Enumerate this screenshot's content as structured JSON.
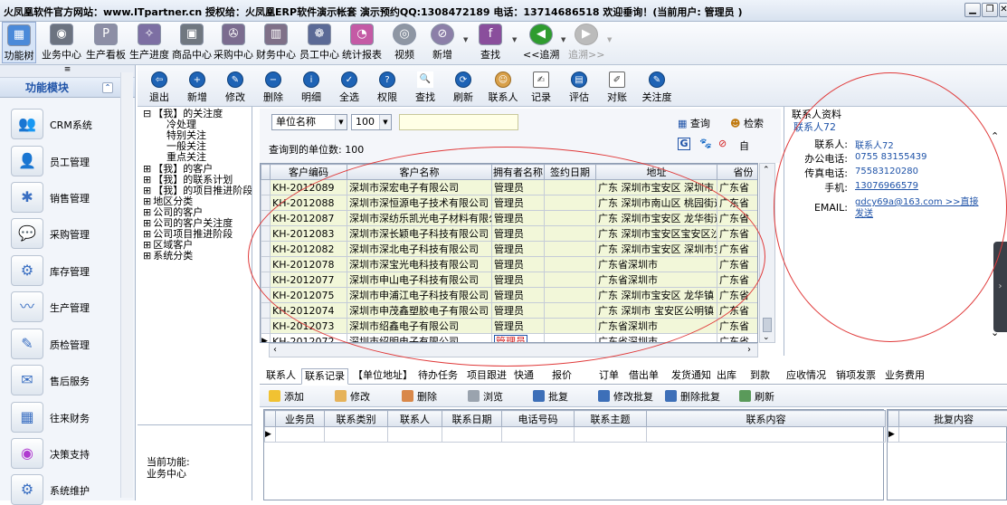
{
  "window": {
    "title": "火凤凰软件官方网站：www.ITpartner.cn  授权给：火凤凰ERP软件演示帐套 演示预约QQ:1308472189 电话：13714686518  欢迎垂询！(当前用户: 管理员 )"
  },
  "toolbar": [
    "功能树",
    "业务中心",
    "生产看板",
    "生产进度",
    "商品中心",
    "采购中心",
    "财务中心",
    "员工中心",
    "统计报表",
    "视频",
    "新增",
    "查找",
    "<<追溯",
    "追溯>>"
  ],
  "leftnav": {
    "collapse_glyph": "≡",
    "header": "功能模块",
    "items": [
      "CRM系统",
      "员工管理",
      "销售管理",
      "采购管理",
      "库存管理",
      "生产管理",
      "质检管理",
      "售后服务",
      "往来财务",
      "决策支持",
      "系统维护"
    ]
  },
  "tree": [
    {
      "label": "【我】的关注度",
      "exp": "⊟"
    },
    {
      "label": "冷处理",
      "exp": ""
    },
    {
      "label": "特别关注",
      "exp": ""
    },
    {
      "label": "一般关注",
      "exp": ""
    },
    {
      "label": "重点关注",
      "exp": ""
    },
    {
      "label": "【我】的客户",
      "exp": "⊞"
    },
    {
      "label": "【我】的联系计划",
      "exp": "⊞"
    },
    {
      "label": "【我】的项目推进阶段",
      "exp": "⊞"
    },
    {
      "label": "地区分类",
      "exp": "⊞"
    },
    {
      "label": "公司的客户",
      "exp": "⊞"
    },
    {
      "label": "公司的客户关注度",
      "exp": "⊞"
    },
    {
      "label": "公司项目推进阶段",
      "exp": "⊞"
    },
    {
      "label": "区域客户",
      "exp": "⊞"
    },
    {
      "label": "系统分类",
      "exp": "⊞"
    }
  ],
  "current_function": {
    "label": "当前功能:",
    "value": "业务中心"
  },
  "main_toolbar": [
    "退出",
    "新增",
    "修改",
    "删除",
    "明细",
    "全选",
    "权限",
    "查找",
    "刷新",
    "联系人",
    "记录",
    "评估",
    "对账",
    "关注度"
  ],
  "search": {
    "field": "单位名称",
    "count": "100",
    "query": "",
    "result_label": "查询到的单位数: 100",
    "btn_query": "查询",
    "btn_search": "检索",
    "btn_self": "自"
  },
  "grid": {
    "columns": [
      "客户编码",
      "客户名称",
      "拥有者名称",
      "签约日期",
      "地址",
      "省份"
    ],
    "rows": [
      [
        "KH-2012089",
        "深圳市深宏电子有限公司",
        "管理员",
        "",
        "广东 深圳市宝安区 深圳市",
        "广东省"
      ],
      [
        "KH-2012088",
        "深圳市深恒源电子技术有限公司",
        "管理员",
        "",
        "广东 深圳市南山区 桃园街道",
        "广东省"
      ],
      [
        "KH-2012087",
        "深圳市深纺乐凯光电子材料有限公司",
        "管理员",
        "",
        "广东 深圳市宝安区 龙华街道",
        "广东省"
      ],
      [
        "KH-2012083",
        "深圳市深长颖电子科技有限公司",
        "管理员",
        "",
        "广东 深圳市宝安区宝安区沙井",
        "广东省"
      ],
      [
        "KH-2012082",
        "深圳市深北电子科技有限公司",
        "管理员",
        "",
        "广东 深圳市宝安区 深圳市宝安",
        "广东省"
      ],
      [
        "KH-2012078",
        "深圳市深宝光电科技有限公司",
        "管理员",
        "",
        "广东省深圳市",
        "广东省"
      ],
      [
        "KH-2012077",
        "深圳市申山电子科技有限公司",
        "管理员",
        "",
        "广东省深圳市",
        "广东省"
      ],
      [
        "KH-2012075",
        "深圳市申浦江电子科技有限公司",
        "管理员",
        "",
        "广东 深圳市宝安区 龙华镇",
        "广东省"
      ],
      [
        "KH-2012074",
        "深圳市申茂鑫塑胶电子有限公司",
        "管理员",
        "",
        "广东 深圳市 宝安区公明镇",
        "广东省"
      ],
      [
        "KH-2012073",
        "深圳市绍鑫电子有限公司",
        "管理员",
        "",
        "广东省深圳市",
        "广东省"
      ],
      [
        "KH-2012072",
        "深圳市绍明电子有限公司",
        "管理员",
        "",
        "广东省深圳市",
        "广东省"
      ]
    ]
  },
  "contact": {
    "caption": "联系人资料",
    "name": "联系人72",
    "fields": [
      {
        "label": "联系人:",
        "value": "联系人72"
      },
      {
        "label": "办公电话:",
        "value": "0755 83155439"
      },
      {
        "label": "传真电话:",
        "value": "75583120280"
      },
      {
        "label": "手机:",
        "value": "13076966579"
      },
      {
        "label": "EMAIL:",
        "value": "gdcy69a@163.com >>直接发送"
      }
    ]
  },
  "tabs": [
    "联系人",
    "联系记录",
    "【单位地址】",
    "待办任务",
    "项目跟进",
    "快通",
    "报价",
    "订单",
    "借出单",
    "发货通知",
    "出库",
    "到款",
    "应收情况",
    "销项发票",
    "业务费用"
  ],
  "lower_toolbar": [
    "添加",
    "修改",
    "删除",
    "浏览",
    "批复",
    "修改批复",
    "删除批复",
    "刷新"
  ],
  "lower_grid": {
    "columns": [
      "业务员",
      "联系类别",
      "联系人",
      "联系日期",
      "电话号码",
      "联系主题",
      "联系内容"
    ]
  },
  "lower_grid2": {
    "columns": [
      "批复内容"
    ]
  },
  "colors": {
    "accent": "#1f53a8",
    "row_bg": "#f2f7d9",
    "ellipse": "#e03a3a"
  }
}
